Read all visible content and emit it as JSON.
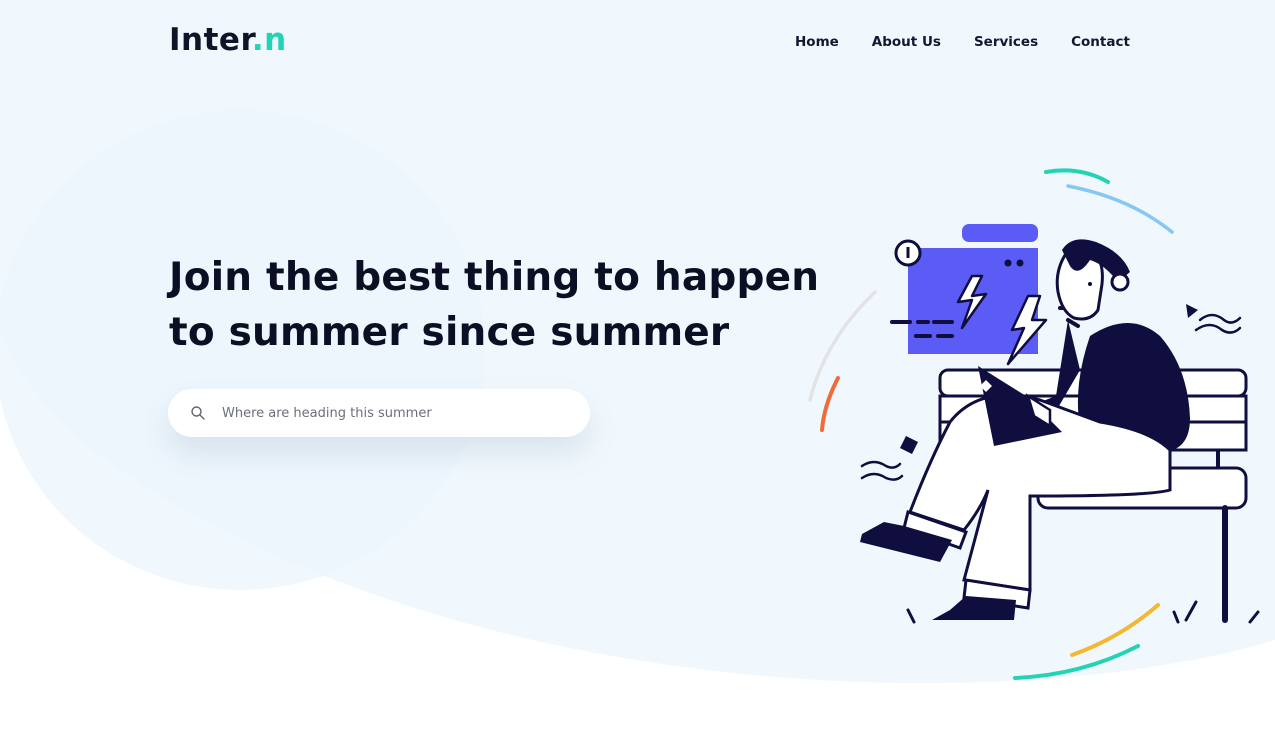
{
  "brand": {
    "name_main": "Inter",
    "name_accent": ".n",
    "accent_color": "#22d3b4"
  },
  "nav": {
    "items": [
      "Home",
      "About Us",
      "Services",
      "Contact"
    ]
  },
  "hero": {
    "title": "Join the best thing to happen to summer since summer"
  },
  "search": {
    "placeholder": "Where are heading this summer",
    "icon": "search-icon"
  },
  "colors": {
    "background": "#f1f8fd",
    "primary_dark": "#0f0e3f",
    "screen_purple": "#5a5cf5",
    "teal": "#22d3b4",
    "blue_arc": "#86c8f5",
    "orange": "#f06a3a",
    "yellow": "#f2b831"
  },
  "illustration": {
    "name": "person-on-bench-with-laptop-illustration"
  }
}
